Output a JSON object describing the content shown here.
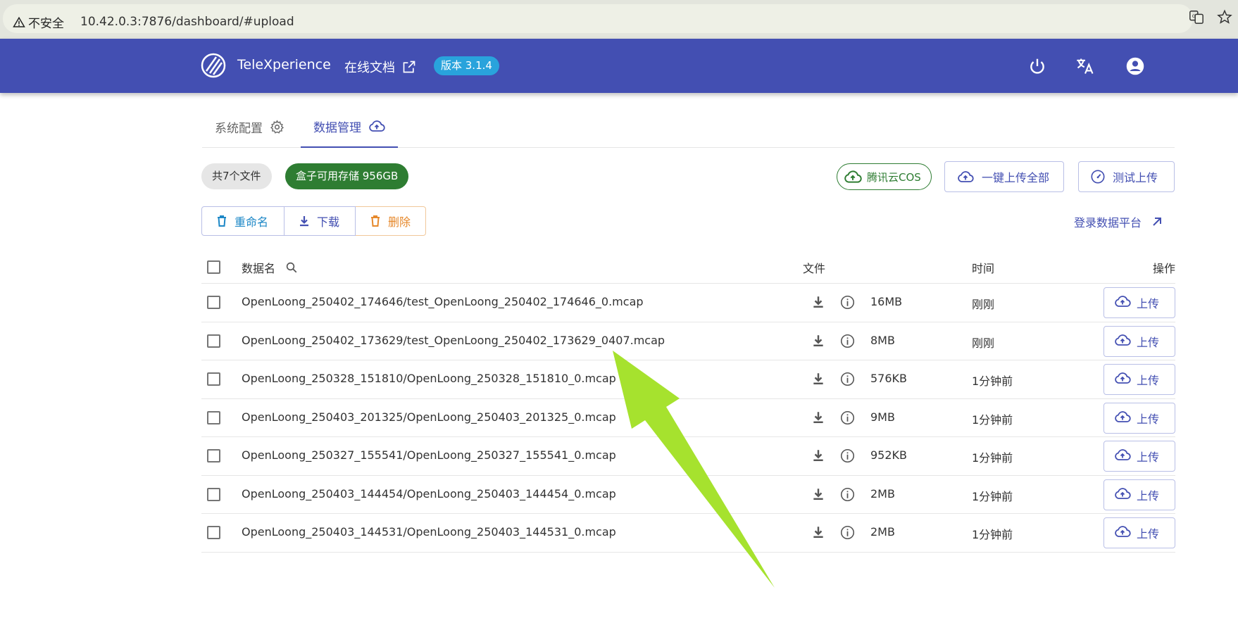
{
  "browser": {
    "insecure_label": "不安全",
    "url": "10.42.0.3:7876/dashboard/#upload",
    "icons": [
      "translate-page-icon",
      "star-bookmark-icon"
    ]
  },
  "header": {
    "app_name": "TeleXperience",
    "docs_label": "在线文档",
    "version_badge": "版本 3.1.4",
    "icons": [
      "power-icon",
      "language-icon",
      "account-icon"
    ],
    "colors": {
      "bar": "#434fb2",
      "badge": "#29a3dc"
    }
  },
  "tabs": [
    {
      "label": "系统配置",
      "icon": "gear-icon",
      "active": false
    },
    {
      "label": "数据管理",
      "icon": "cloud-upload-icon",
      "active": true
    }
  ],
  "summary": {
    "file_count": "共7个文件",
    "storage": "盒子可用存储 956GB",
    "cos_label": "腾讯云COS",
    "upload_all_label": "一键上传全部",
    "test_upload_label": "测试上传"
  },
  "actions": {
    "rename_label": "重命名",
    "download_label": "下载",
    "delete_label": "删除",
    "platform_label": "登录数据平台"
  },
  "table": {
    "headers": {
      "name": "数据名",
      "file": "文件",
      "time": "时间",
      "op": "操作"
    },
    "upload_label": "上传",
    "rows": [
      {
        "name": "OpenLoong_250402_174646/test_OpenLoong_250402_174646_0.mcap",
        "size": "16MB",
        "time": "刚刚"
      },
      {
        "name": "OpenLoong_250402_173629/test_OpenLoong_250402_173629_0407.mcap",
        "size": "8MB",
        "time": "刚刚"
      },
      {
        "name": "OpenLoong_250328_151810/OpenLoong_250328_151810_0.mcap",
        "size": "576KB",
        "time": "1分钟前"
      },
      {
        "name": "OpenLoong_250403_201325/OpenLoong_250403_201325_0.mcap",
        "size": "9MB",
        "time": "1分钟前"
      },
      {
        "name": "OpenLoong_250327_155541/OpenLoong_250327_155541_0.mcap",
        "size": "952KB",
        "time": "1分钟前"
      },
      {
        "name": "OpenLoong_250403_144454/OpenLoong_250403_144454_0.mcap",
        "size": "2MB",
        "time": "1分钟前"
      },
      {
        "name": "OpenLoong_250403_144531/OpenLoong_250403_144531_0.mcap",
        "size": "2MB",
        "time": "1分钟前"
      }
    ]
  },
  "annotation": {
    "arrow_color": "#a6e22e"
  }
}
